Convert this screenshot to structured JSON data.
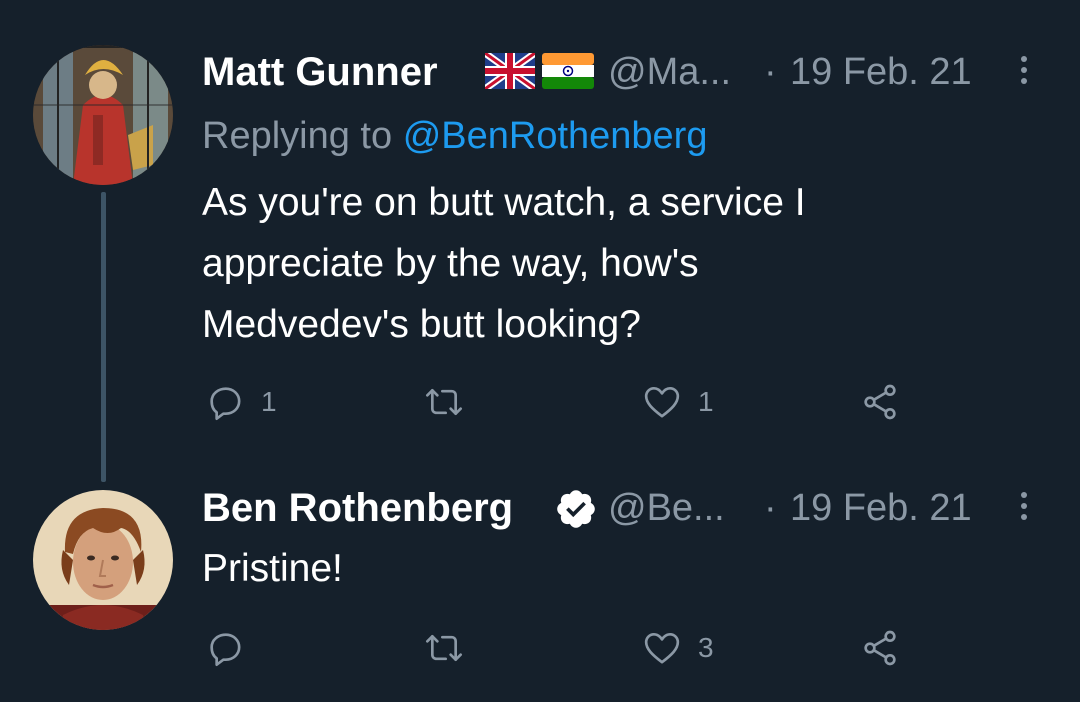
{
  "colors": {
    "background": "#15202b",
    "primary_text": "#ffffff",
    "secondary_text": "#8b98a5",
    "link": "#1d9bf0",
    "thread_line": "#3d5466"
  },
  "tweets": [
    {
      "author_name": "Matt Gunner",
      "flags": [
        "uk-flag-icon",
        "india-flag-icon"
      ],
      "handle": "@Ma...",
      "separator": "·",
      "date": "19 Feb. 21",
      "replying_prefix": "Replying to",
      "replying_to": "@BenRothenberg",
      "text_lines": [
        "As you're on butt watch, a service I",
        "appreciate by the way, how's",
        "Medvedev's butt looking?"
      ],
      "replies": "1",
      "retweets": "",
      "likes": "1",
      "avatar": "stained-glass-avatar"
    },
    {
      "author_name": "Ben Rothenberg",
      "verified": true,
      "handle": "@Be...",
      "separator": "·",
      "date": "19 Feb. 21",
      "text_lines": [
        "Pristine!"
      ],
      "replies": "",
      "retweets": "",
      "likes": "3",
      "avatar": "person-photo-avatar"
    }
  ]
}
